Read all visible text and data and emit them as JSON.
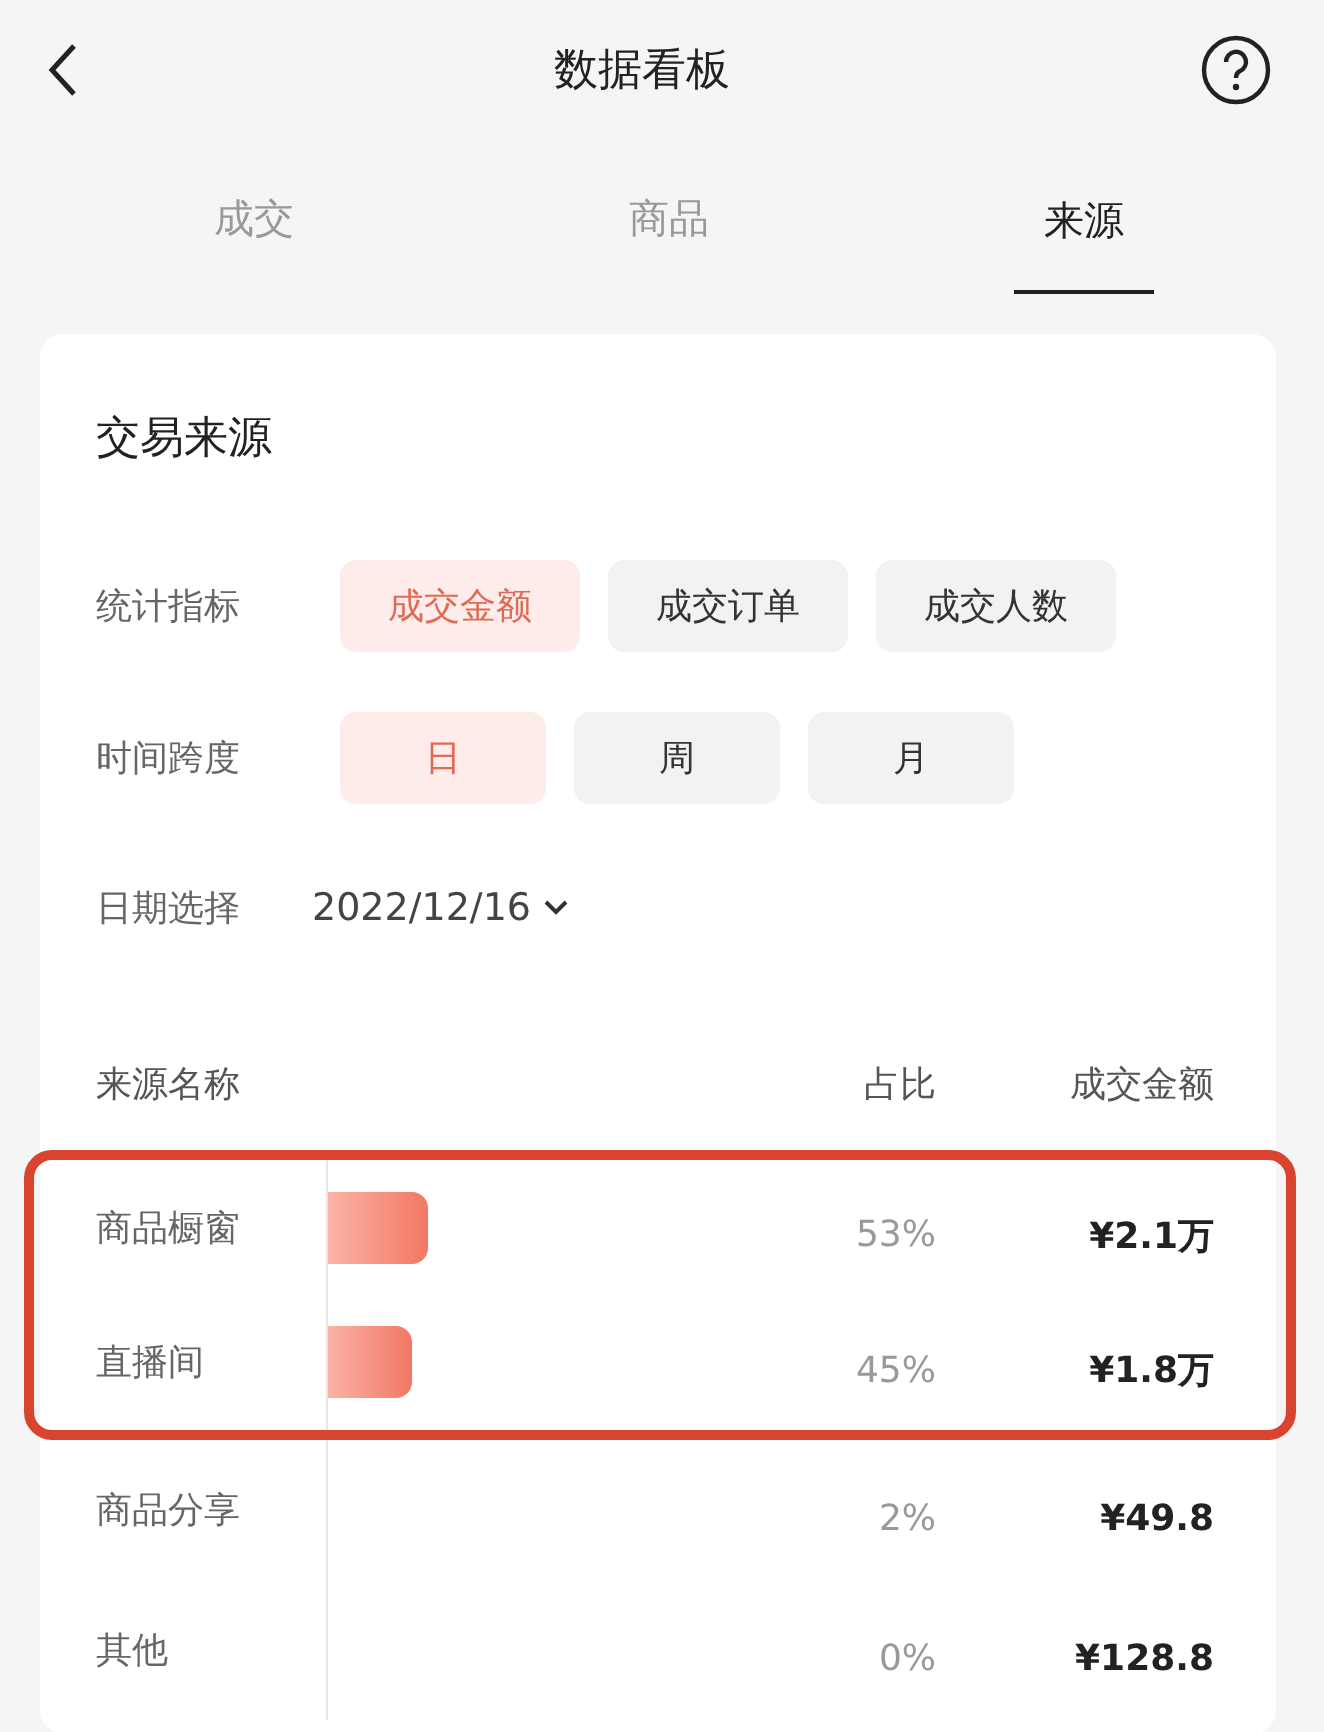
{
  "header": {
    "title": "数据看板"
  },
  "tabs": [
    {
      "label": "成交",
      "selected": false
    },
    {
      "label": "商品",
      "selected": false
    },
    {
      "label": "来源",
      "selected": true
    }
  ],
  "card": {
    "title": "交易来源",
    "filters": [
      {
        "label": "统计指标",
        "options": [
          {
            "label": "成交金额",
            "selected": true
          },
          {
            "label": "成交订单",
            "selected": false
          },
          {
            "label": "成交人数",
            "selected": false
          }
        ]
      },
      {
        "label": "时间跨度",
        "options": [
          {
            "label": "日",
            "selected": true
          },
          {
            "label": "周",
            "selected": false
          },
          {
            "label": "月",
            "selected": false
          }
        ]
      }
    ],
    "date": {
      "label": "日期选择",
      "value": "2022/12/16"
    },
    "table": {
      "columns": [
        "来源名称",
        "占比",
        "成交金额"
      ],
      "rows": [
        {
          "name": "商品橱窗",
          "bar": true,
          "share": "53%",
          "amount": "¥2.1万",
          "highlighted": true
        },
        {
          "name": "直播间",
          "bar": true,
          "share": "45%",
          "amount": "¥1.8万",
          "highlighted": true
        },
        {
          "name": "商品分享",
          "bar": false,
          "share": "2%",
          "amount": "¥49.8",
          "highlighted": false
        },
        {
          "name": "其他",
          "bar": false,
          "share": "0%",
          "amount": "¥128.8",
          "highlighted": false
        }
      ]
    }
  }
}
